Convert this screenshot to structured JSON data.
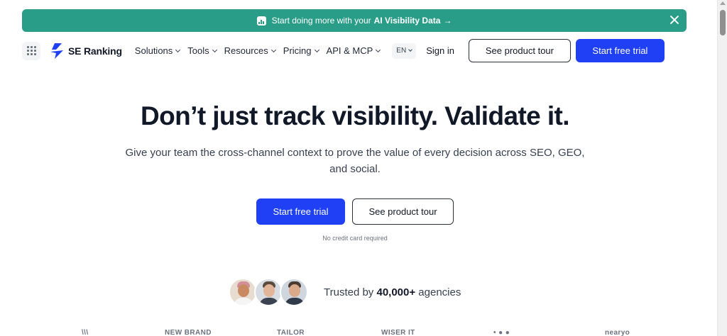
{
  "banner": {
    "text": "Start doing more with your",
    "highlight": "AI Visibility Data",
    "arrow": "→",
    "icon": "chart-icon"
  },
  "nav": {
    "logo_text": "SE Ranking",
    "menu": [
      {
        "label": "Solutions"
      },
      {
        "label": "Tools"
      },
      {
        "label": "Resources"
      },
      {
        "label": "Pricing"
      },
      {
        "label": "API & MCP"
      }
    ],
    "lang": "EN",
    "sign_in": "Sign in",
    "tour_label": "See product tour",
    "trial_label": "Start free trial"
  },
  "hero": {
    "title": "Don’t just track visibility. Validate it.",
    "subtitle": "Give your team the cross-channel context to prove the value of every decision across SEO, GEO, and social.",
    "primary_cta": "Start free trial",
    "secondary_cta": "See product tour",
    "note": "No credit card required"
  },
  "trusted": {
    "prefix": "Trusted by",
    "count": "40,000+",
    "suffix": "agencies"
  },
  "logos": [
    "NEW BRAND",
    "TAILOR",
    "WISER IT",
    "nearyo"
  ],
  "colors": {
    "banner_bg": "#2a9d88",
    "primary": "#1f40f5",
    "text": "#111827"
  }
}
